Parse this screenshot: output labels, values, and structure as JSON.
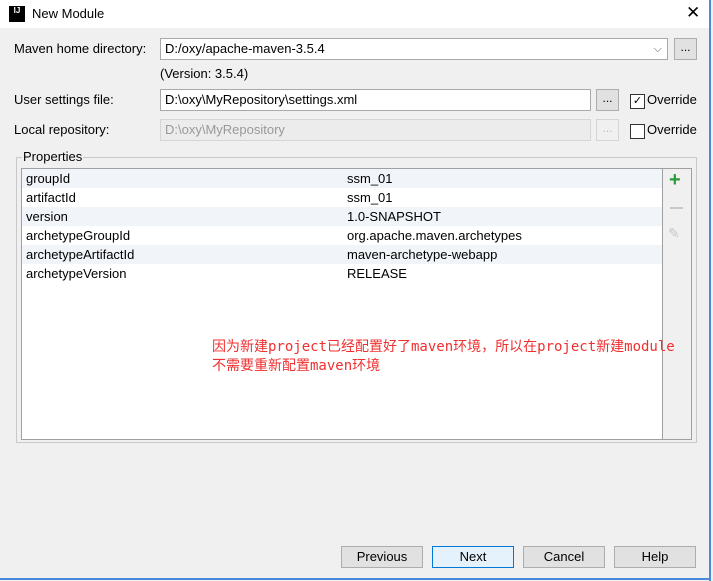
{
  "window": {
    "title": "New Module",
    "app_icon": "IJ"
  },
  "form": {
    "maven_home_label": "Maven home directory:",
    "maven_home_value": "D:/oxy/apache-maven-3.5.4",
    "version": "(Version: 3.5.4)",
    "user_settings_label": "User settings file:",
    "user_settings_value": "D:\\oxy\\MyRepository\\settings.xml",
    "user_settings_override": true,
    "local_repo_label": "Local repository:",
    "local_repo_value": "D:\\oxy\\MyRepository",
    "local_repo_override": false,
    "override_label": "Override",
    "browse_label": "..."
  },
  "properties": {
    "title": "Properties",
    "rows": [
      {
        "key": "groupId",
        "value": "ssm_01"
      },
      {
        "key": "artifactId",
        "value": "ssm_01"
      },
      {
        "key": "version",
        "value": "1.0-SNAPSHOT"
      },
      {
        "key": "archetypeGroupId",
        "value": "org.apache.maven.archetypes"
      },
      {
        "key": "archetypeArtifactId",
        "value": "maven-archetype-webapp"
      },
      {
        "key": "archetypeVersion",
        "value": "RELEASE"
      }
    ]
  },
  "annotation": {
    "line1": "因为新建project已经配置好了maven环境，所以在project新建module",
    "line2": "不需要重新配置maven环境",
    "color": "#f03030"
  },
  "buttons": {
    "previous": "Previous",
    "next": "Next",
    "cancel": "Cancel",
    "help": "Help"
  }
}
